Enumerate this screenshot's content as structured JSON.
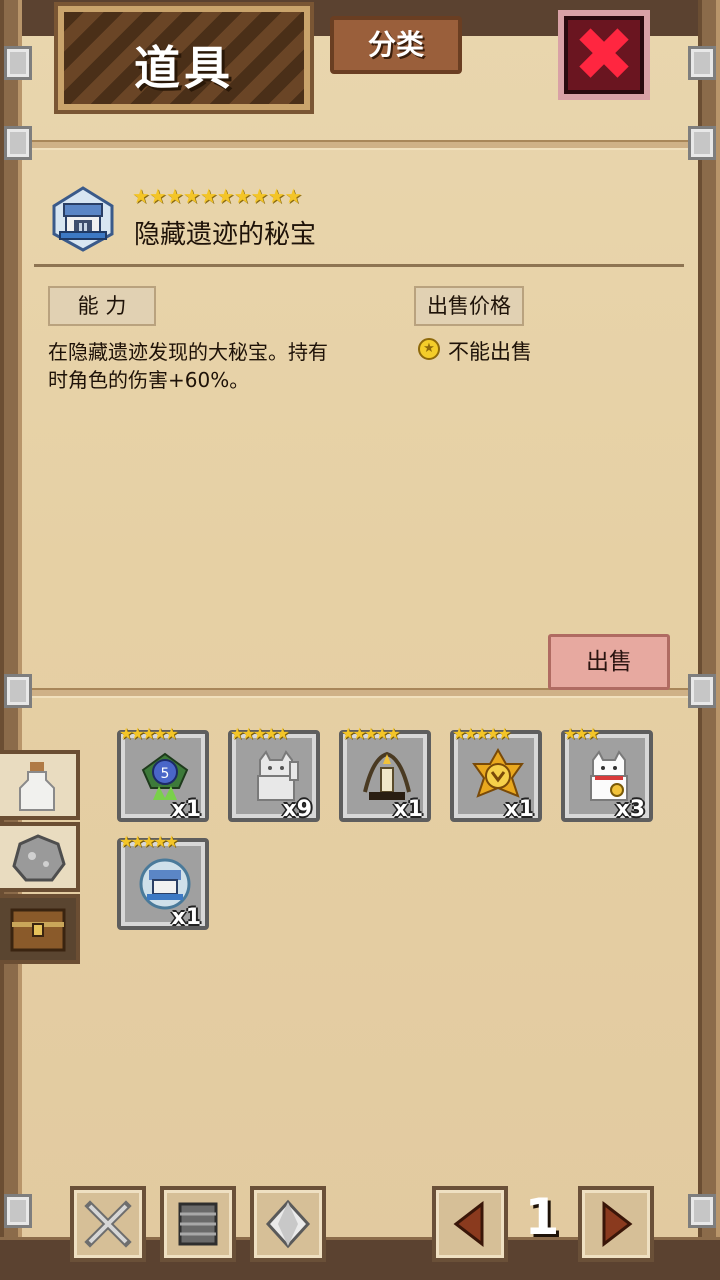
{
  "header": {
    "title": "道具",
    "category_label": "分类"
  },
  "item": {
    "name": "隐藏遗迹的秘宝",
    "stars": "★★★★★★★★★★",
    "ability_label": "能 力",
    "description_line1": "在隐藏遗迹发现的大秘宝。持有",
    "description_line2": "时角色的伤害+60%。",
    "price_label": "出售价格",
    "price_value": "不能出售"
  },
  "sell_button_label": "出售",
  "inventory": {
    "slots": [
      {
        "name": "blue-orb-relic",
        "stars": "★★★★★",
        "count": "x1"
      },
      {
        "name": "white-lucky-cat",
        "stars": "★★★★★",
        "count": "x9"
      },
      {
        "name": "leaf-candle-relic",
        "stars": "★★★★★",
        "count": "x1"
      },
      {
        "name": "golden-medal",
        "stars": "★★★★★",
        "count": "x1"
      },
      {
        "name": "lucky-cat",
        "stars": "★★★",
        "count": "x3"
      },
      {
        "name": "hidden-ruins-treasure",
        "stars": "★★★★★",
        "count": "x1"
      }
    ]
  },
  "pager": {
    "current_page": "1"
  },
  "colors": {
    "parchment": "#e6d0a4",
    "close_red": "#ff2640",
    "sell_pink": "#e7a9a0",
    "star_gold": "#f4c527"
  }
}
